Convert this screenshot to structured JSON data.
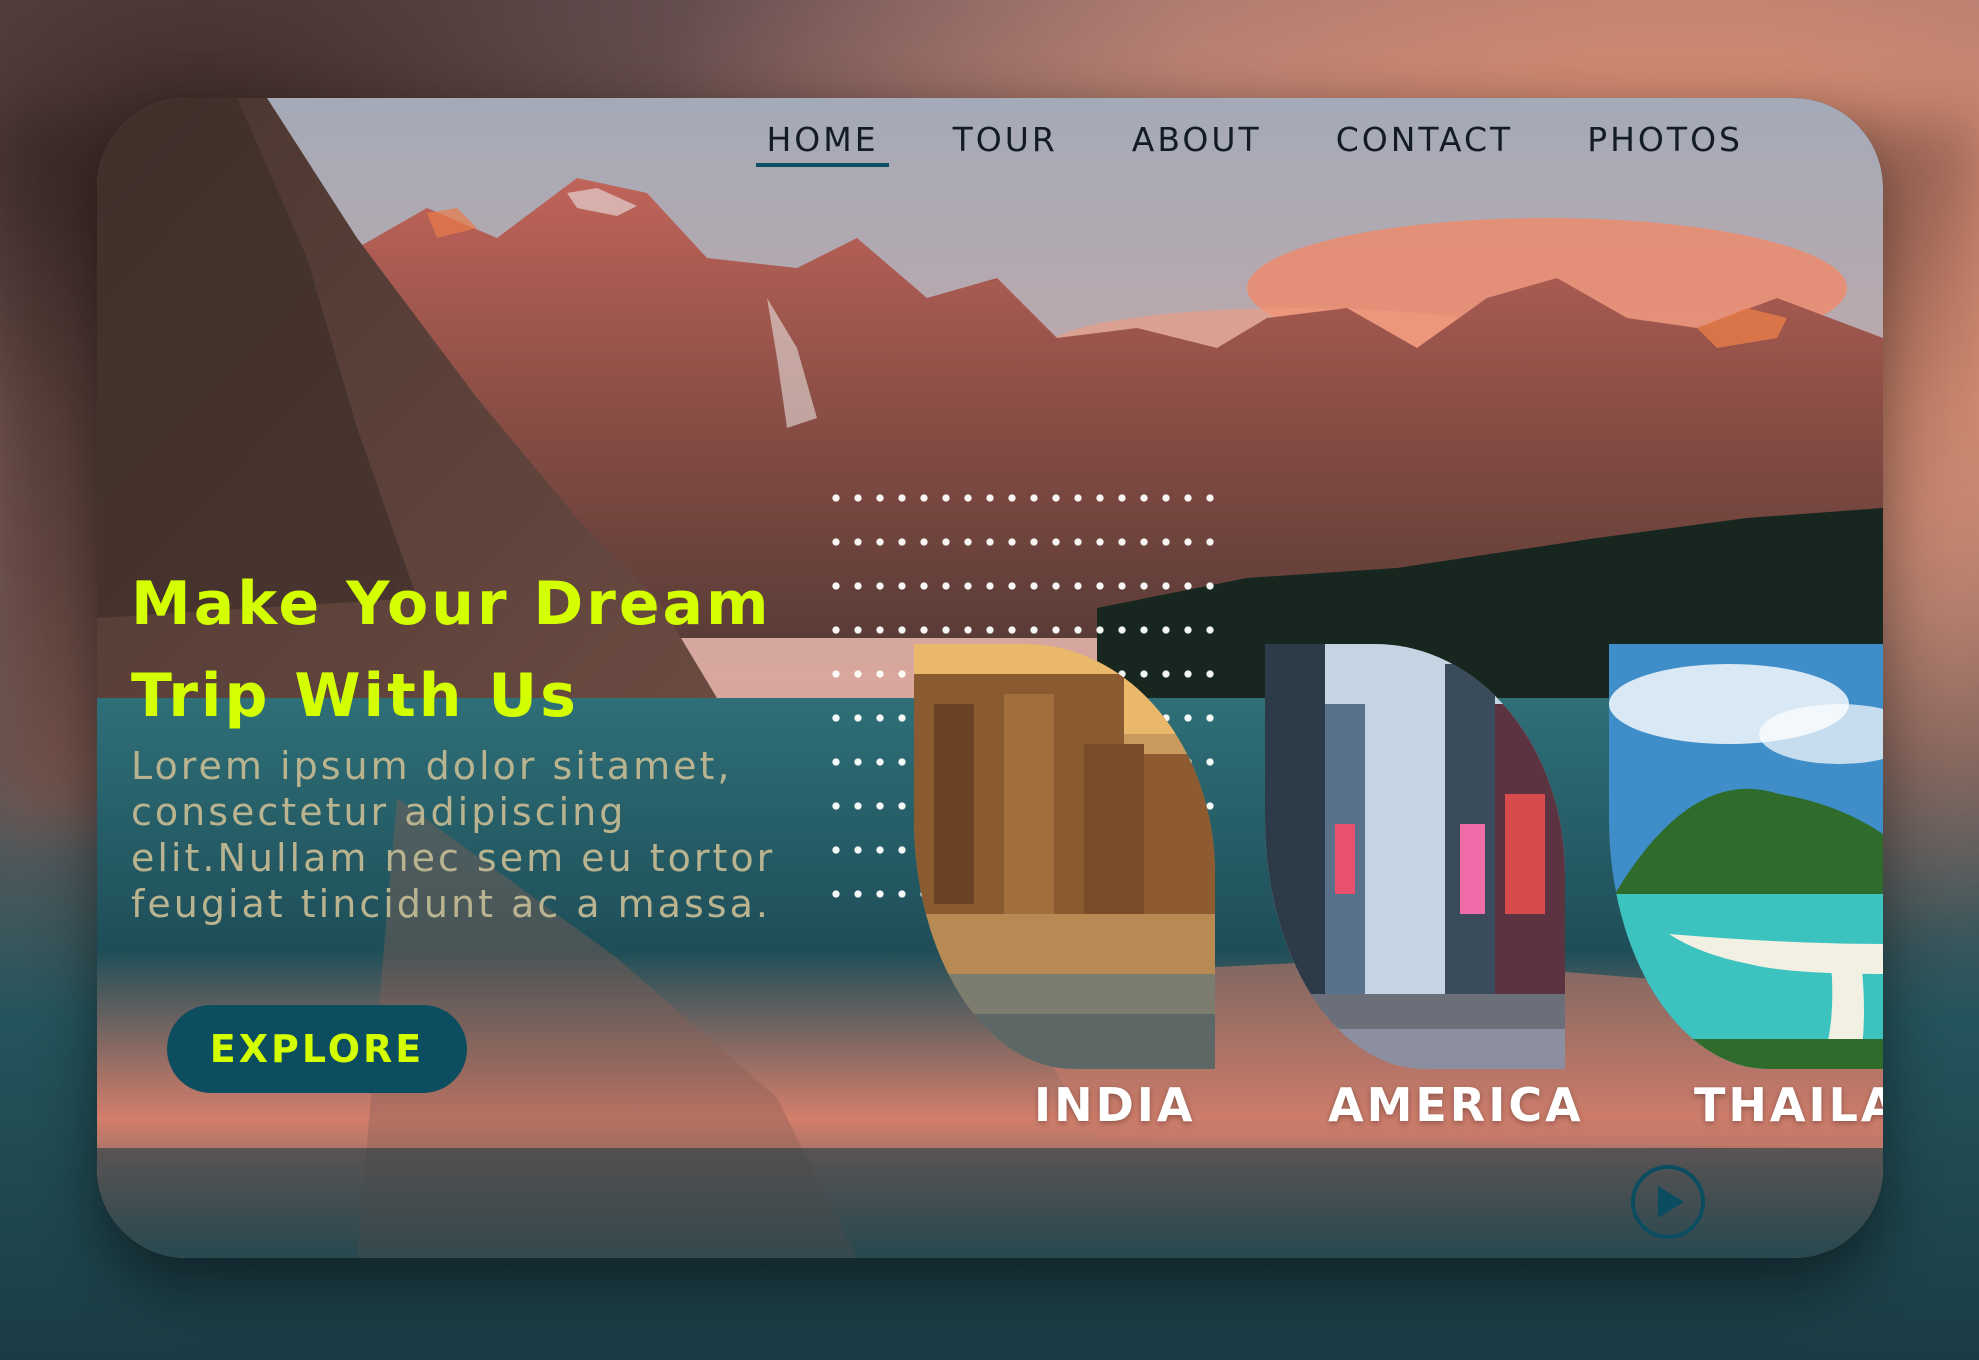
{
  "nav": {
    "items": [
      {
        "label": "HOME",
        "active": true
      },
      {
        "label": "TOUR",
        "active": false
      },
      {
        "label": "ABOUT",
        "active": false
      },
      {
        "label": "CONTACT",
        "active": false
      },
      {
        "label": "PHOTOS",
        "active": false
      }
    ]
  },
  "hero": {
    "headline_line1": "Make Your Dream",
    "headline_line2": "Trip With Us",
    "body": "Lorem ipsum dolor sitamet, consectetur adipiscing elit.Nullam nec sem eu tortor feugiat tincidunt ac a massa.",
    "explore_label": "EXPLORE"
  },
  "destinations": [
    {
      "label": "INDIA"
    },
    {
      "label": "AMERICA"
    },
    {
      "label": "THAILA"
    }
  ],
  "colors": {
    "accent": "#d4ff00",
    "primary": "#0c4d5f",
    "nav_text": "#121c22"
  },
  "icons": {
    "play": "play-icon"
  }
}
